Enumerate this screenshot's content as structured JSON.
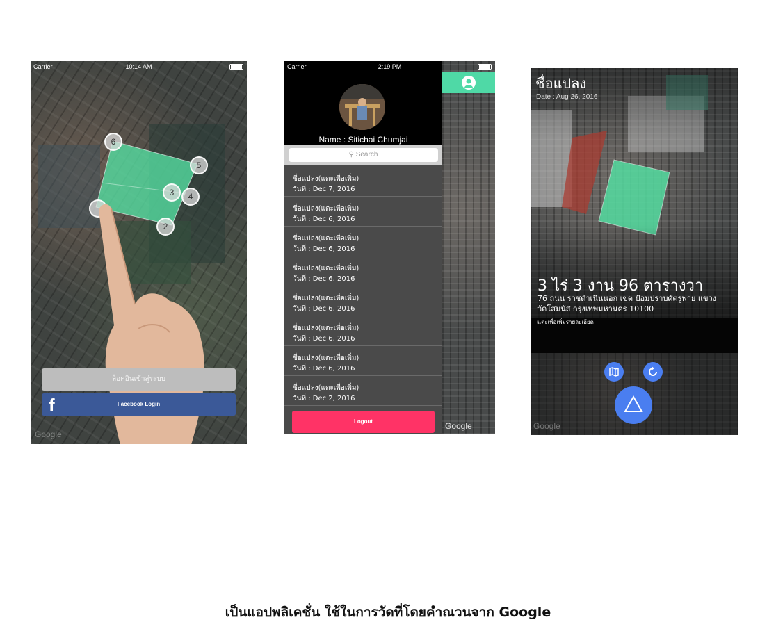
{
  "phone1": {
    "status": {
      "carrier": "Carrier",
      "time": "10:14 AM"
    },
    "markers": [
      "6",
      "5",
      "3",
      "4",
      "2"
    ],
    "login_button": "ล็อคอินเข้าสู่ระบบ",
    "facebook_button": "Facebook Login",
    "facebook_glyph": "f",
    "map_brand": "Google"
  },
  "phone2": {
    "status": {
      "carrier": "Carrier",
      "time": "2:19 PM"
    },
    "profile_name": "Name : Sitichai Chumjai",
    "search_placeholder": "Search",
    "items": [
      {
        "title": "ชื่อแปลง(แตะเพื่อเพิ่ม)",
        "date": "วันที่ : Dec 7, 2016"
      },
      {
        "title": "ชื่อแปลง(แตะเพื่อเพิ่ม)",
        "date": "วันที่ : Dec 6, 2016"
      },
      {
        "title": "ชื่อแปลง(แตะเพื่อเพิ่ม)",
        "date": "วันที่ : Dec 6, 2016"
      },
      {
        "title": "ชื่อแปลง(แตะเพื่อเพิ่ม)",
        "date": "วันที่ : Dec 6, 2016"
      },
      {
        "title": "ชื่อแปลง(แตะเพื่อเพิ่ม)",
        "date": "วันที่ : Dec 6, 2016"
      },
      {
        "title": "ชื่อแปลง(แตะเพื่อเพิ่ม)",
        "date": "วันที่ : Dec 6, 2016"
      },
      {
        "title": "ชื่อแปลง(แตะเพื่อเพิ่ม)",
        "date": "วันที่ : Dec 6, 2016"
      },
      {
        "title": "ชื่อแปลง(แตะเพื่อเพิ่ม)",
        "date": "วันที่ : Dec 2, 2016"
      }
    ],
    "logout_button": "Logout",
    "map_brand": "Google",
    "colors": {
      "accent": "#4fd9a6",
      "logout": "#ff3366"
    }
  },
  "phone3": {
    "plot_name": "ชื่อแปลง",
    "date": "Date : Aug 26, 2016",
    "area": "3 ไร่ 3 งาน 96 ตารางวา",
    "address_line1": "76 ถนน ราชดำเนินนอก เขต ป้อมปราบศัตรูพ่าย แขวง",
    "address_line2": "วัดโสมนัส กรุงเทพมหานคร 10100",
    "hint": "แตะเพื่อเพิ่มรายละเอียด",
    "map_brand": "Google",
    "icons": [
      "map-icon",
      "refresh-icon",
      "triangle-icon"
    ]
  },
  "caption": "เป็นแอปพลิเคชั่น ใช้ในการวัดที่โดยคำณวนจาก Google"
}
